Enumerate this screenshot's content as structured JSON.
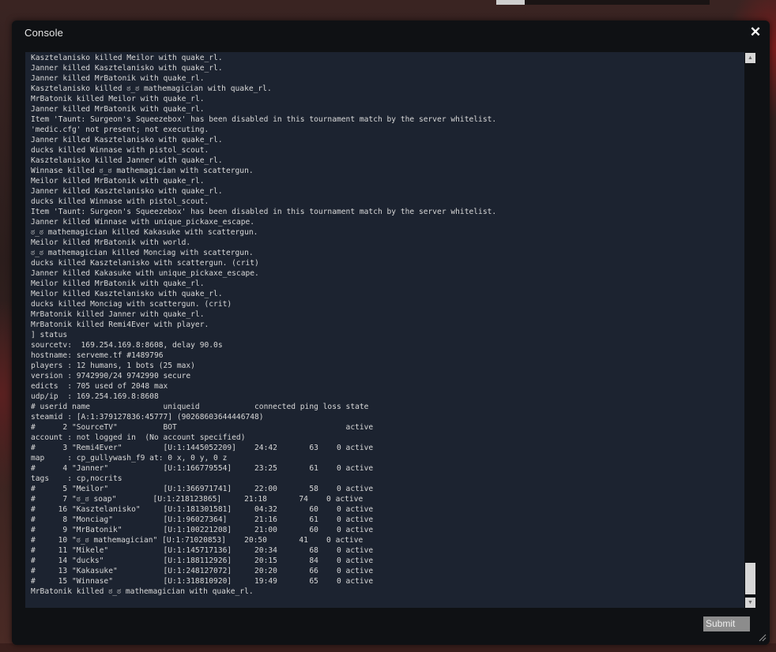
{
  "window": {
    "title": "Console",
    "close_symbol": "✕",
    "submit_label": "Submit"
  },
  "input": {
    "value": "",
    "placeholder": ""
  },
  "icons": {
    "close": "close-icon",
    "scroll_up": "arrow-up-icon",
    "scroll_down": "arrow-down-icon",
    "resize": "resize-grip-icon"
  },
  "colors": {
    "console_bg": "#1c2330",
    "dialog_bg": "#0f1114",
    "text": "#d8d8d8",
    "submit_bg": "#8c8c8c"
  },
  "scroll": {
    "position": 1.0
  },
  "console_lines": [
    "Kasztelanisko killed Meilor with quake_rl.",
    "Janner killed Kasztelanisko with quake_rl.",
    "Janner killed MrBatonik with quake_rl.",
    "Kasztelanisko killed ಠ_ಠ mathemagician with quake_rl.",
    "MrBatonik killed Meilor with quake_rl.",
    "Janner killed MrBatonik with quake_rl.",
    "Item 'Taunt: Surgeon's Squeezebox' has been disabled in this tournament match by the server whitelist.",
    "'medic.cfg' not present; not executing.",
    "Janner killed Kasztelanisko with quake_rl.",
    "ducks killed Winnase with pistol_scout.",
    "Kasztelanisko killed Janner with quake_rl.",
    "Winnase killed ಠ_ಠ mathemagician with scattergun.",
    "Meilor killed MrBatonik with quake_rl.",
    "Janner killed Kasztelanisko with quake_rl.",
    "ducks killed Winnase with pistol_scout.",
    "Item 'Taunt: Surgeon's Squeezebox' has been disabled in this tournament match by the server whitelist.",
    "Janner killed Winnase with unique_pickaxe_escape.",
    "ಠ_ಠ mathemagician killed Kakasuke with scattergun.",
    "Meilor killed MrBatonik with world.",
    "ಠ_ಠ mathemagician killed Monciag with scattergun.",
    "ducks killed Kasztelanisko with scattergun. (crit)",
    "Janner killed Kakasuke with unique_pickaxe_escape.",
    "Meilor killed MrBatonik with quake_rl.",
    "Meilor killed Kasztelanisko with quake_rl.",
    "ducks killed Monciag with scattergun. (crit)",
    "MrBatonik killed Janner with quake_rl.",
    "MrBatonik killed Remi4Ever with player.",
    "] status",
    "sourcetv:  169.254.169.8:8608, delay 90.0s",
    "hostname: serveme.tf #1489796",
    "players : 12 humans, 1 bots (25 max)",
    "version : 9742990/24 9742990 secure",
    "edicts  : 705 used of 2048 max",
    "udp/ip  : 169.254.169.8:8608",
    "# userid name                uniqueid            connected ping loss state",
    "steamid : [A:1:379127836:45777] (90268603644446748)",
    "#      2 \"SourceTV\"          BOT                                     active",
    "account : not logged in  (No account specified)",
    "#      3 \"Remi4Ever\"         [U:1:1445052209]    24:42       63    0 active",
    "map     : cp_gullywash_f9 at: 0 x, 0 y, 0 z",
    "#      4 \"Janner\"            [U:1:166779554]     23:25       61    0 active",
    "tags    : cp,nocrits",
    "#      5 \"Meilor\"            [U:1:366971741]     22:00       58    0 active",
    "#      7 \"ಠ_ಠ soap\"        [U:1:218123865]     21:18       74    0 active",
    "#     16 \"Kasztelanisko\"     [U:1:181301581]     04:32       60    0 active",
    "#      8 \"Monciag\"           [U:1:96027364]      21:16       61    0 active",
    "#      9 \"MrBatonik\"         [U:1:100221208]     21:00       60    0 active",
    "#     10 \"ಠ_ಠ mathemagician\" [U:1:71020853]    20:50       41    0 active",
    "#     11 \"Mikele\"            [U:1:145717136]     20:34       68    0 active",
    "#     14 \"ducks\"             [U:1:188112926]     20:15       84    0 active",
    "#     13 \"Kakasuke\"          [U:1:248127072]     20:20       66    0 active",
    "#     15 \"Winnase\"           [U:1:318810920]     19:49       65    0 active",
    "MrBatonik killed ಠ_ಠ mathemagician with quake_rl."
  ]
}
